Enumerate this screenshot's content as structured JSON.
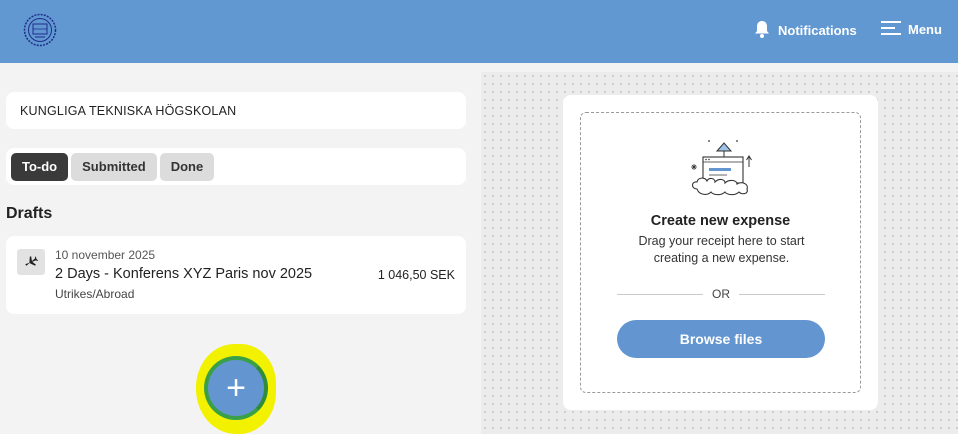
{
  "header": {
    "notifications_label": "Notifications",
    "menu_label": "Menu",
    "brand_color": "#6298d2"
  },
  "organization": {
    "name": "KUNGLIGA TEKNISKA HÖGSKOLAN"
  },
  "tabs": [
    {
      "label": "To-do",
      "active": true
    },
    {
      "label": "Submitted",
      "active": false
    },
    {
      "label": "Done",
      "active": false
    }
  ],
  "drafts": {
    "title": "Drafts",
    "items": [
      {
        "icon": "airplane-icon",
        "date": "10 november 2025",
        "title": "2 Days - Konferens XYZ Paris nov 2025",
        "category": "Utrikes/Abroad",
        "amount": "1 046,50 SEK"
      }
    ]
  },
  "fab": {
    "label": "+"
  },
  "upload": {
    "title": "Create new expense",
    "description": "Drag your receipt here to start creating a new expense.",
    "or_label": "OR",
    "browse_label": "Browse files",
    "accent_color": "#6396d0"
  }
}
